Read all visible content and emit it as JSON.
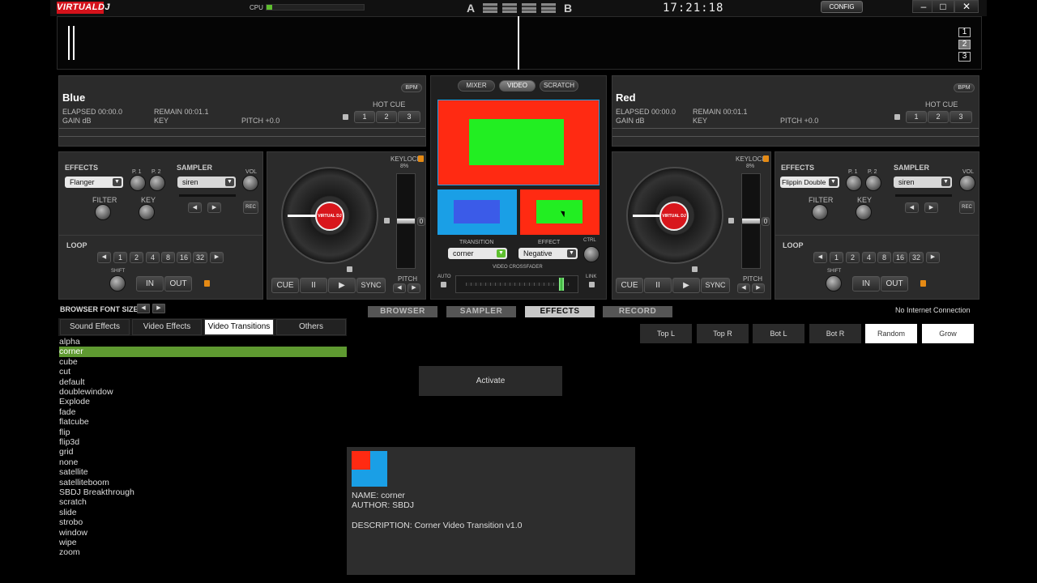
{
  "app": {
    "logo": "VIRTUALDJ",
    "cpu_label": "CPU",
    "cpu_load": 0.06,
    "crossfade_a": "A",
    "crossfade_b": "B",
    "clock": "17:21:18",
    "config_label": "CONFIG",
    "min_icon": "minimize-icon",
    "max_icon": "maximize-icon",
    "close_icon": "close-icon"
  },
  "pages": [
    "1",
    "2",
    "3"
  ],
  "deck_left": {
    "name": "Blue",
    "bpm_label": "BPM",
    "elapsed": "ELAPSED 00:00.0",
    "remain": "REMAIN 00:01.1",
    "gain": "GAIN dB",
    "key": "KEY",
    "pitch": "PITCH +0.0",
    "hotcue_label": "HOT CUE",
    "hotcues": [
      "1",
      "2",
      "3"
    ],
    "effects_label": "EFFECTS",
    "effect": "Flanger",
    "p1": "P. 1",
    "p2": "P. 2",
    "sampler_label": "SAMPLER",
    "sample": "siren",
    "vol": "VOL",
    "filter": "FILTER",
    "key_knob": "KEY",
    "rec": "REC",
    "loop_label": "LOOP",
    "loops": [
      "1",
      "2",
      "4",
      "8",
      "16",
      "32"
    ],
    "shift": "SHIFT",
    "in": "IN",
    "out": "OUT",
    "keylock": "KEYLOCK",
    "keylock_pct": "8%",
    "zero": "0",
    "cue": "CUE",
    "pause": "II",
    "play": "▶",
    "sync": "SYNC",
    "pitch_label": "PITCH",
    "platter_logo": "VIRTUAL DJ"
  },
  "deck_right": {
    "name": "Red",
    "bpm_label": "BPM",
    "elapsed": "ELAPSED 00:00.0",
    "remain": "REMAIN 00:01.1",
    "gain": "GAIN dB",
    "key": "KEY",
    "pitch": "PITCH +0.0",
    "hotcue_label": "HOT CUE",
    "hotcues": [
      "1",
      "2",
      "3"
    ],
    "effects_label": "EFFECTS",
    "effect": "Flippin Double",
    "p1": "P. 1",
    "p2": "P. 2",
    "sampler_label": "SAMPLER",
    "sample": "siren",
    "vol": "VOL",
    "filter": "FILTER",
    "key_knob": "KEY",
    "rec": "REC",
    "loop_label": "LOOP",
    "loops": [
      "1",
      "2",
      "4",
      "8",
      "16",
      "32"
    ],
    "shift": "SHIFT",
    "in": "IN",
    "out": "OUT",
    "keylock": "KEYLOCK",
    "keylock_pct": "8%",
    "zero": "0",
    "cue": "CUE",
    "pause": "II",
    "play": "▶",
    "sync": "SYNC",
    "pitch_label": "PITCH",
    "platter_logo": "VIRTUAL DJ"
  },
  "center": {
    "tabs": [
      "MIXER",
      "VIDEO",
      "SCRATCH"
    ],
    "transition_label": "TRANSITION",
    "transition": "corner",
    "effect_label": "EFFECT",
    "effect": "Negative",
    "ctrl": "CTRL",
    "crossfader_label": "VIDEO CROSSFADER",
    "auto": "AUTO",
    "link": "LINK",
    "colors": {
      "red": "#ff2a12",
      "green": "#22ee22",
      "blue": "#1a9fe6",
      "darkblue": "#3b5be8"
    }
  },
  "browser": {
    "font_size_label": "BROWSER FONT SIZE",
    "nav": [
      "BROWSER",
      "SAMPLER",
      "EFFECTS",
      "RECORD"
    ],
    "status": "No Internet Connection",
    "tabs": [
      "Sound Effects",
      "Video Effects",
      "Video Transitions",
      "Others"
    ],
    "items": [
      "alpha",
      "corner",
      "cube",
      "cut",
      "default",
      "doublewindow",
      "Explode",
      "fade",
      "flatcube",
      "flip",
      "flip3d",
      "grid",
      "none",
      "satellite",
      "satelliteboom",
      "SBDJ Breakthrough",
      "scratch",
      "slide",
      "strobo",
      "window",
      "wipe",
      "zoom"
    ],
    "selected_index": 1,
    "position_buttons": [
      "Top L",
      "Top R",
      "Bot L",
      "Bot R",
      "Random",
      "Grow"
    ],
    "activate": "Activate",
    "info": {
      "name": "NAME: corner",
      "author": "AUTHOR: SBDJ",
      "description": "DESCRIPTION: Corner Video Transition v1.0"
    }
  }
}
